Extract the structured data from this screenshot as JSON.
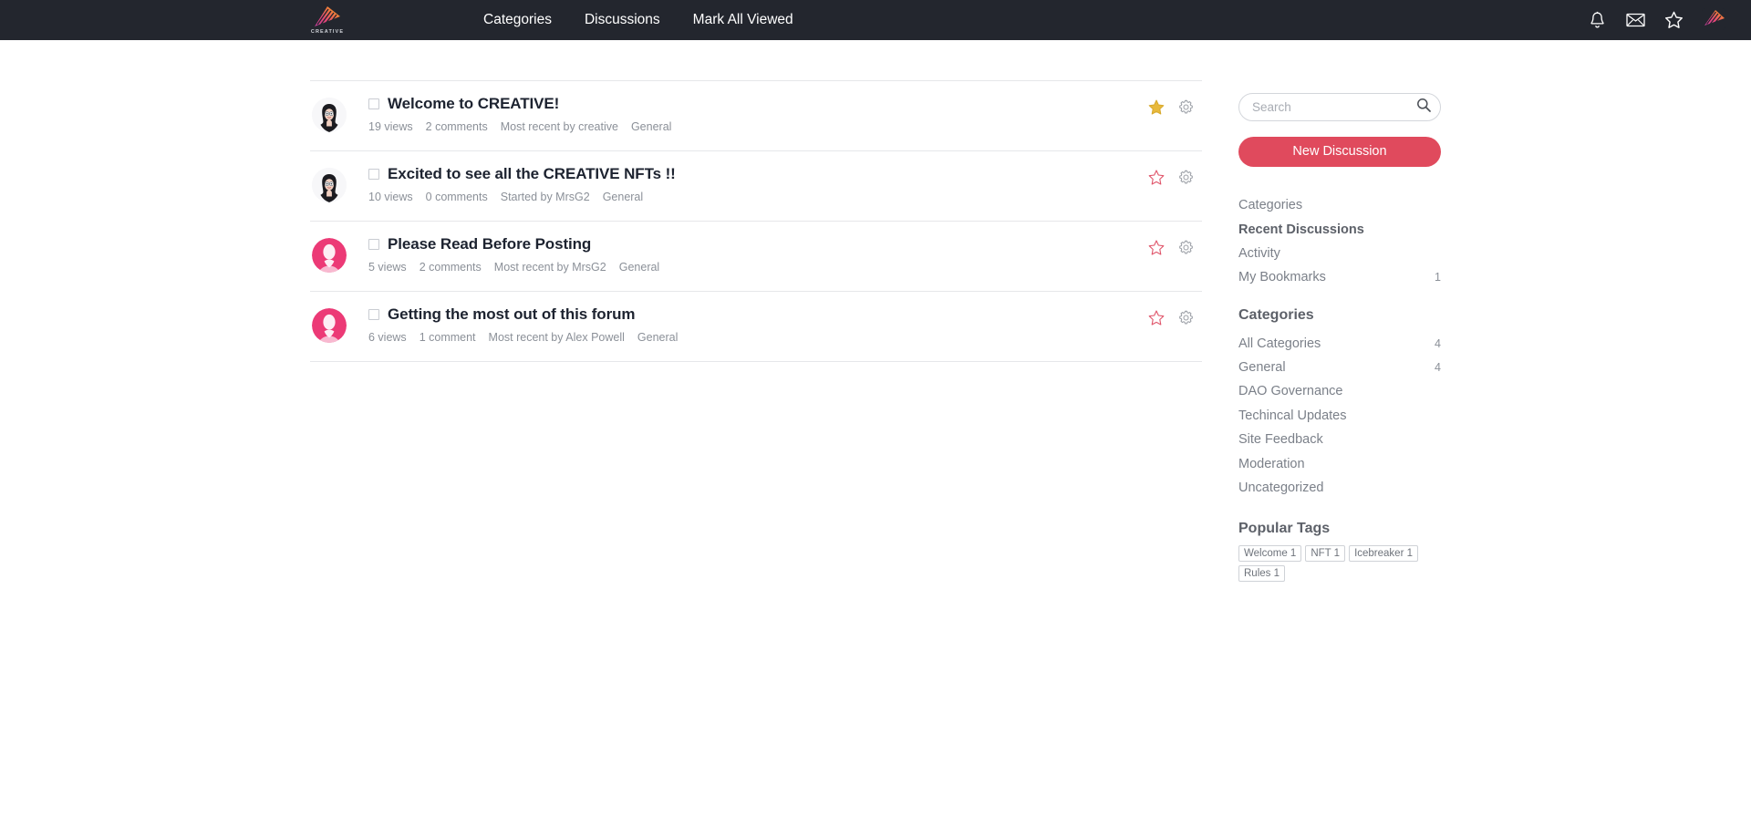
{
  "header": {
    "brand": {
      "name": "CREATIVE",
      "wordmark": "CREATIVE",
      "icon": "creative-logo-icon"
    },
    "nav": [
      {
        "label": "Categories",
        "name": "nav-link-categories"
      },
      {
        "label": "Discussions",
        "name": "nav-link-discussions"
      },
      {
        "label": "Mark All Viewed",
        "name": "nav-link-mark-all-viewed"
      }
    ],
    "tools": [
      {
        "icon": "bell-icon",
        "name": "notifications-button"
      },
      {
        "icon": "envelope-icon",
        "name": "messages-button"
      },
      {
        "icon": "star-icon",
        "name": "bookmarks-button"
      },
      {
        "icon": "user-avatar-icon",
        "name": "user-menu-button"
      }
    ],
    "background": "#23262e"
  },
  "discussions": [
    {
      "title": "Welcome to CREATIVE!",
      "views": "19 views",
      "comments": "2 comments",
      "activity": "Most recent by creative",
      "category": "General",
      "avatar": "photo",
      "bookmarked": true
    },
    {
      "title": "Excited to see all the CREATIVE NFTs !!",
      "views": "10 views",
      "comments": "0 comments",
      "activity": "Started by MrsG2",
      "category": "General",
      "avatar": "photo",
      "bookmarked": false
    },
    {
      "title": "Please Read Before Posting",
      "views": "5 views",
      "comments": "2 comments",
      "activity": "Most recent by MrsG2",
      "category": "General",
      "avatar": "default",
      "bookmarked": false
    },
    {
      "title": "Getting the most out of this forum",
      "views": "6 views",
      "comments": "1 comment",
      "activity": "Most recent by Alex Powell",
      "category": "General",
      "avatar": "default",
      "bookmarked": false
    }
  ],
  "sidebar": {
    "search": {
      "placeholder": "Search",
      "value": "",
      "icon": "search-icon"
    },
    "new_discussion_label": "New Discussion",
    "nav": [
      {
        "label": "Categories",
        "count": "",
        "active": false
      },
      {
        "label": "Recent Discussions",
        "count": "",
        "active": true
      },
      {
        "label": "Activity",
        "count": "",
        "active": false
      },
      {
        "label": "My Bookmarks",
        "count": "1",
        "active": false
      }
    ],
    "categories_heading": "Categories",
    "categories": [
      {
        "label": "All Categories",
        "count": "4"
      },
      {
        "label": "General",
        "count": "4"
      },
      {
        "label": "DAO Governance",
        "count": ""
      },
      {
        "label": "Techincal Updates",
        "count": ""
      },
      {
        "label": "Site Feedback",
        "count": ""
      },
      {
        "label": "Moderation",
        "count": ""
      },
      {
        "label": "Uncategorized",
        "count": ""
      }
    ],
    "tags_heading": "Popular Tags",
    "tags": [
      {
        "label": "Welcome 1"
      },
      {
        "label": "NFT 1"
      },
      {
        "label": "Icebreaker 1"
      },
      {
        "label": "Rules 1"
      }
    ]
  },
  "colors": {
    "accent": "#e04a5d",
    "header_bg": "#23262e",
    "star_active": "#e8b93c",
    "star_inactive": "#e0566b"
  }
}
